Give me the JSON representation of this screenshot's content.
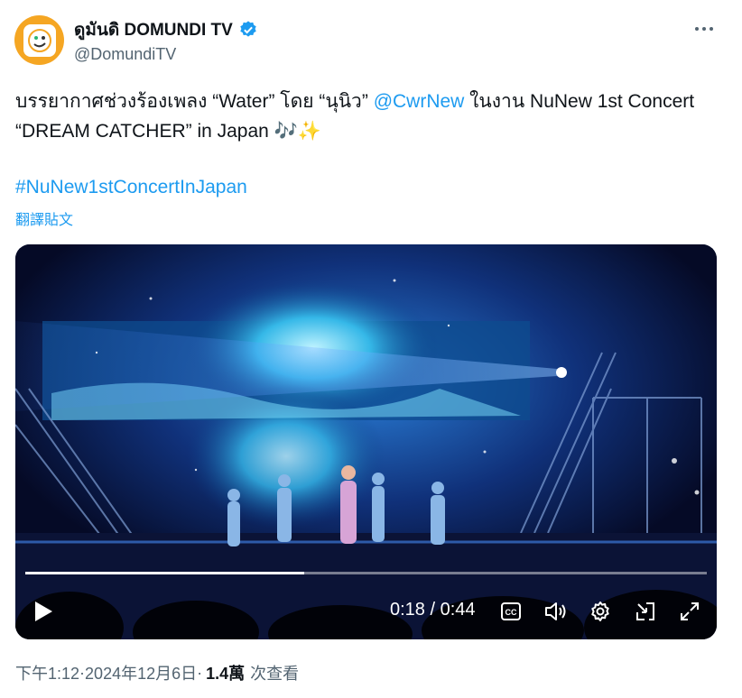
{
  "author": {
    "display_name": "ดูมันดิ DOMUNDI TV",
    "handle": "@DomundiTV",
    "verified": true,
    "avatar_color": "#f5a623"
  },
  "tweet": {
    "text_part1": "บรรยากาศช่วงร้องเพลง “Water” โดย “นุนิว” ",
    "mention": "@CwrNew",
    "text_part2": " ในงาน NuNew 1st Concert “DREAM CATCHER” in Japan ",
    "emoji": "🎶✨",
    "hashtag": "#NuNew1stConcertInJapan",
    "translate_label": "翻譯貼文"
  },
  "video": {
    "current_time": "0:18",
    "separator": " / ",
    "duration": "0:44",
    "progress": 0.409,
    "controls": [
      "play-icon",
      "captions-icon",
      "volume-icon",
      "settings-icon",
      "pip-icon",
      "fullscreen-icon"
    ]
  },
  "meta": {
    "time": "下午1:12",
    "dot1": " · ",
    "date": "2024年12月6日",
    "dot2": " · ",
    "views_count": "1.4萬",
    "views_label": "次查看"
  },
  "colors": {
    "link": "#1d9bf0",
    "secondary_text": "#536471",
    "verified": "#1d9bf0"
  }
}
